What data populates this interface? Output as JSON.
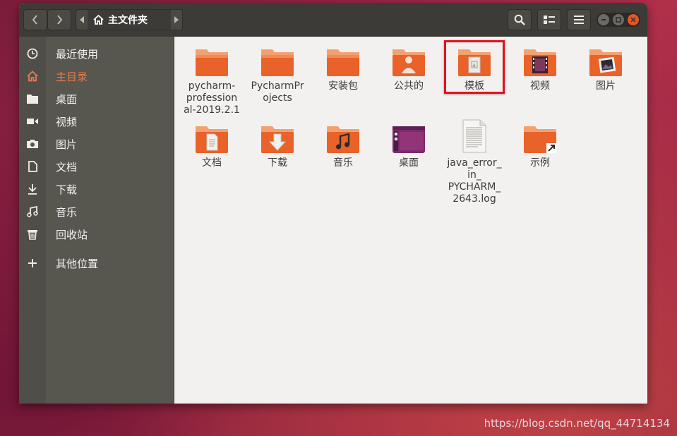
{
  "window": {
    "location": "主文件夹",
    "icons": {
      "back": "chevron-left-icon",
      "forward": "chevron-right-icon",
      "search": "search-icon",
      "view": "list-view-icon",
      "menu": "hamburger-menu-icon",
      "home": "home-icon"
    }
  },
  "colors": {
    "accent": "#e95420",
    "folder_top": "#f1925f",
    "folder_body": "#e8622a",
    "highlight_box": "#e1121c"
  },
  "sidebar": {
    "items": [
      {
        "label": "最近使用",
        "icon": "clock-icon"
      },
      {
        "label": "主目录",
        "icon": "home-icon",
        "active": true
      },
      {
        "label": "桌面",
        "icon": "folder-icon"
      },
      {
        "label": "视频",
        "icon": "video-icon"
      },
      {
        "label": "图片",
        "icon": "camera-icon"
      },
      {
        "label": "文档",
        "icon": "document-icon"
      },
      {
        "label": "下载",
        "icon": "download-icon"
      },
      {
        "label": "音乐",
        "icon": "music-icon"
      },
      {
        "label": "回收站",
        "icon": "trash-icon"
      },
      {
        "label": "其他位置",
        "icon": "plus-icon"
      }
    ]
  },
  "files": [
    {
      "name": "pycharm-professional-2019.2.1",
      "lines": [
        "pycharm-",
        "profession",
        "al-2019.2.1"
      ],
      "icon": "folder-icon"
    },
    {
      "name": "PycharmProjects",
      "lines": [
        "PycharmPr",
        "ojects"
      ],
      "icon": "folder-icon"
    },
    {
      "name": "安装包",
      "lines": [
        "安装包"
      ],
      "icon": "folder-icon"
    },
    {
      "name": "公共的",
      "lines": [
        "公共的"
      ],
      "icon": "public-folder-icon"
    },
    {
      "name": "模板",
      "lines": [
        "模板"
      ],
      "icon": "templates-folder-icon"
    },
    {
      "name": "视频",
      "lines": [
        "视频"
      ],
      "icon": "videos-folder-icon"
    },
    {
      "name": "图片",
      "lines": [
        "图片"
      ],
      "icon": "pictures-folder-icon"
    },
    {
      "name": "文档",
      "lines": [
        "文档"
      ],
      "icon": "documents-folder-icon"
    },
    {
      "name": "下载",
      "lines": [
        "下载"
      ],
      "icon": "downloads-folder-icon"
    },
    {
      "name": "音乐",
      "lines": [
        "音乐"
      ],
      "icon": "music-folder-icon"
    },
    {
      "name": "桌面",
      "lines": [
        "桌面"
      ],
      "icon": "desktop-folder-icon"
    },
    {
      "name": "java_error_in_PYCHARM_2643.log",
      "lines": [
        "java_error_",
        "in_",
        "PYCHARM_",
        "2643.log"
      ],
      "icon": "text-file-icon"
    },
    {
      "name": "示例",
      "lines": [
        "示例"
      ],
      "icon": "examples-folder-icon"
    }
  ],
  "watermark": "https://blog.csdn.net/qq_44714134"
}
